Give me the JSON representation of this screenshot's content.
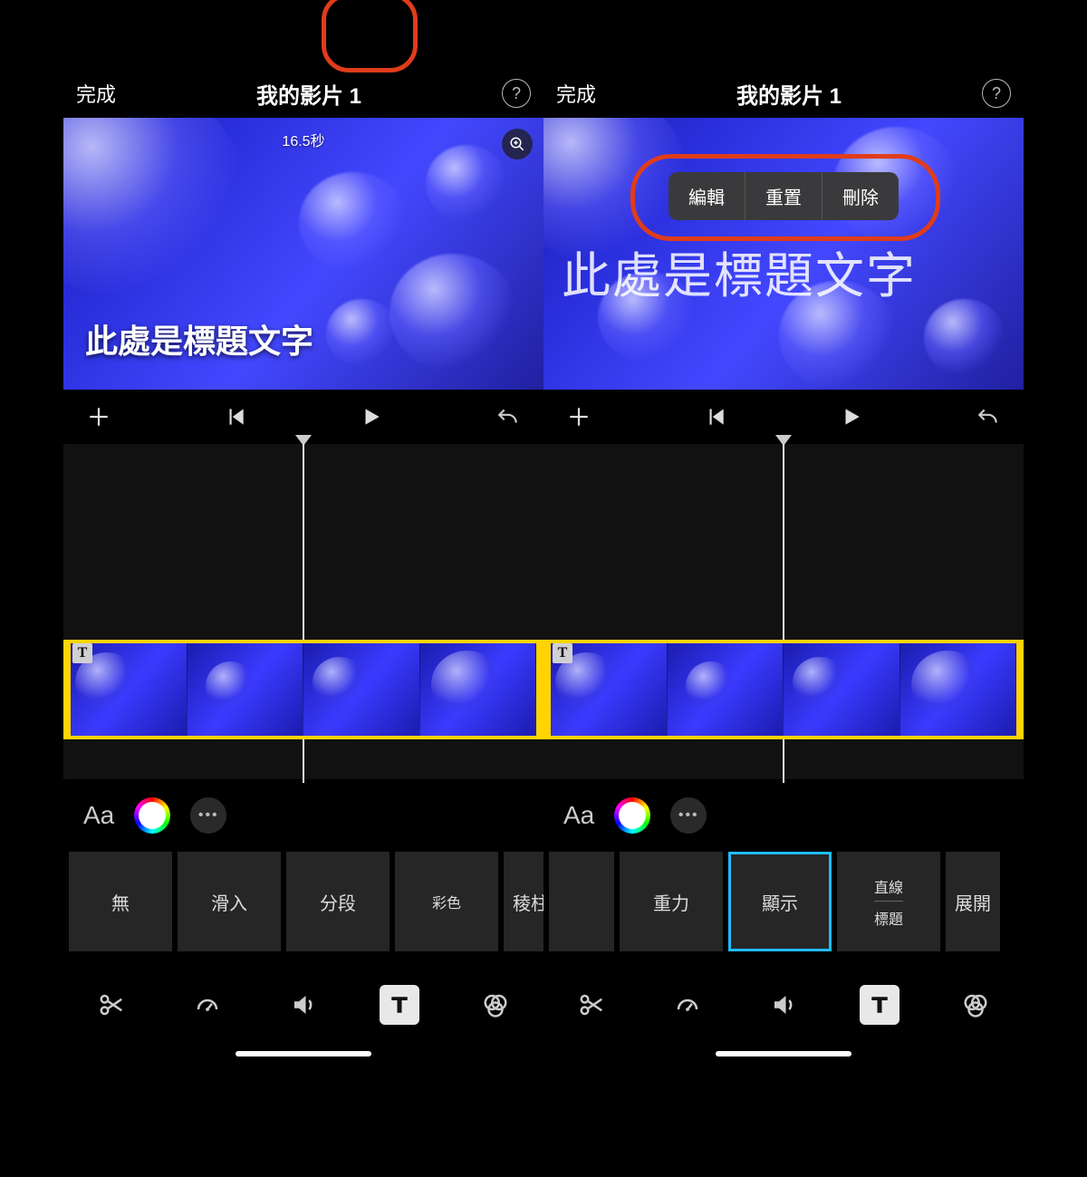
{
  "left": {
    "header": {
      "done": "完成",
      "title": "我的影片 1"
    },
    "preview": {
      "time_label": "16.5秒",
      "title_text": "此處是標題文字"
    },
    "style_row": {
      "items": [
        "無",
        "滑入",
        "分段",
        "彩色",
        "稜柱"
      ]
    },
    "options": {
      "font_label": "Aa"
    }
  },
  "right": {
    "header": {
      "done": "完成",
      "title": "我的影片 1"
    },
    "preview": {
      "title_text": "此處是標題文字",
      "context_menu": {
        "edit": "編輯",
        "reset": "重置",
        "delete": "刪除"
      }
    },
    "style_row": {
      "items": [
        "重力",
        "顯示"
      ],
      "stack": {
        "top": "直線",
        "bottom": "標題"
      },
      "last": "展開",
      "selected_index": 1
    },
    "options": {
      "font_label": "Aa"
    }
  }
}
